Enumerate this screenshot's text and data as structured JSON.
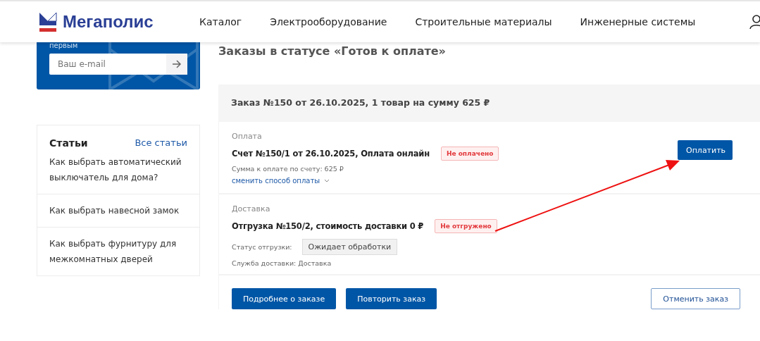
{
  "header": {
    "logo_text": "Мегаполис",
    "nav": [
      {
        "label": "Каталог"
      },
      {
        "label": "Электрооборудование"
      },
      {
        "label": "Строительные материалы"
      },
      {
        "label": "Инженерные системы"
      }
    ]
  },
  "subscribe": {
    "text": "первым",
    "placeholder": "Ваш e-mail"
  },
  "articles": {
    "title": "Статьи",
    "all_link": "Все статьи",
    "items": [
      "Как выбрать автоматический выключатель для дома?",
      "Как выбрать навесной замок",
      "Как выбрать фурнитуру для межкомнатных дверей"
    ]
  },
  "page_title": "Заказы в статусе «Готов к оплате»",
  "order": {
    "title": "Заказ №150 от 26.10.2025, 1 товар на сумму 625 ₽",
    "payment": {
      "label": "Оплата",
      "title": "Счет №150/1 от 26.10.2025, Оплата онлайн",
      "status": "Не оплачено",
      "amount": "Сумма к оплате по счету: 625 ₽",
      "change_link": "сменить способ оплаты",
      "pay_button": "Оплатить"
    },
    "delivery": {
      "label": "Доставка",
      "title": "Отгрузка №150/2, стоимость доставки 0 ₽",
      "status": "Не отгружено",
      "status_label": "Статус отгрузки:",
      "status_value": "Ожидает обработки",
      "service": "Служба доставки: Доставка"
    },
    "buttons": [
      {
        "label": "Подробнее о заказе",
        "kind": "primary"
      },
      {
        "label": "Повторить заказ",
        "kind": "primary"
      },
      {
        "label": "Отменить заказ",
        "kind": "outline"
      }
    ]
  }
}
